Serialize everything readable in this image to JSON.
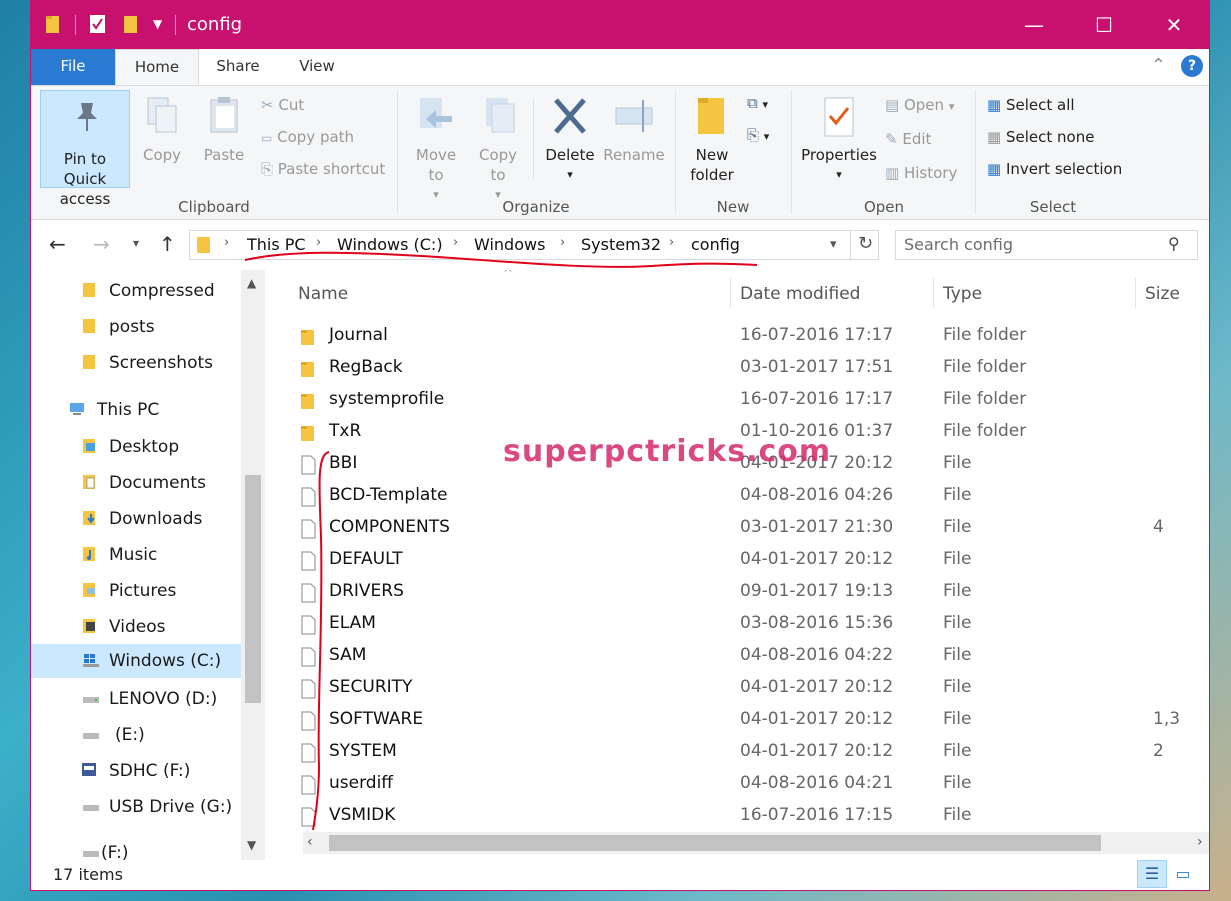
{
  "window": {
    "title": "config"
  },
  "tabs": [
    "File",
    "Home",
    "Share",
    "View"
  ],
  "ribbon": {
    "clipboard": {
      "label": "Clipboard",
      "pin": "Pin to Quick access",
      "copy": "Copy",
      "paste": "Paste",
      "cut": "Cut",
      "copy_path": "Copy path",
      "paste_shortcut": "Paste shortcut"
    },
    "organize": {
      "label": "Organize",
      "move_to": "Move to",
      "copy_to": "Copy to",
      "delete": "Delete",
      "rename": "Rename"
    },
    "new": {
      "label": "New",
      "new_folder": "New folder"
    },
    "open": {
      "label": "Open",
      "properties": "Properties",
      "open": "Open",
      "edit": "Edit",
      "history": "History"
    },
    "select": {
      "label": "Select",
      "select_all": "Select all",
      "select_none": "Select none",
      "invert": "Invert selection"
    }
  },
  "address": {
    "crumbs": [
      "This PC",
      "Windows (C:)",
      "Windows",
      "System32",
      "config"
    ],
    "search_placeholder": "Search config"
  },
  "nav": [
    {
      "label": "Compressed"
    },
    {
      "label": "posts"
    },
    {
      "label": "Screenshots"
    },
    {
      "label": "This PC"
    },
    {
      "label": "Desktop"
    },
    {
      "label": "Documents"
    },
    {
      "label": "Downloads"
    },
    {
      "label": "Music"
    },
    {
      "label": "Pictures"
    },
    {
      "label": "Videos"
    },
    {
      "label": "Windows (C:)"
    },
    {
      "label": "LENOVO (D:)"
    },
    {
      "label": "(E:)"
    },
    {
      "label": "SDHC (F:)"
    },
    {
      "label": "USB Drive (G:)"
    },
    {
      "label": "(F:)"
    }
  ],
  "columns": {
    "name": "Name",
    "date": "Date modified",
    "type": "Type",
    "size": "Size"
  },
  "files": [
    {
      "name": "Journal",
      "date": "16-07-2016 17:17",
      "type": "File folder",
      "size": "",
      "folder": true
    },
    {
      "name": "RegBack",
      "date": "03-01-2017 17:51",
      "type": "File folder",
      "size": "",
      "folder": true
    },
    {
      "name": "systemprofile",
      "date": "16-07-2016 17:17",
      "type": "File folder",
      "size": "",
      "folder": true
    },
    {
      "name": "TxR",
      "date": "01-10-2016 01:37",
      "type": "File folder",
      "size": "",
      "folder": true
    },
    {
      "name": "BBI",
      "date": "04-01-2017 20:12",
      "type": "File",
      "size": "",
      "folder": false
    },
    {
      "name": "BCD-Template",
      "date": "04-08-2016 04:26",
      "type": "File",
      "size": "",
      "folder": false
    },
    {
      "name": "COMPONENTS",
      "date": "03-01-2017 21:30",
      "type": "File",
      "size": "4",
      "folder": false
    },
    {
      "name": "DEFAULT",
      "date": "04-01-2017 20:12",
      "type": "File",
      "size": "",
      "folder": false
    },
    {
      "name": "DRIVERS",
      "date": "09-01-2017 19:13",
      "type": "File",
      "size": "",
      "folder": false
    },
    {
      "name": "ELAM",
      "date": "03-08-2016 15:36",
      "type": "File",
      "size": "",
      "folder": false
    },
    {
      "name": "SAM",
      "date": "04-08-2016 04:22",
      "type": "File",
      "size": "",
      "folder": false
    },
    {
      "name": "SECURITY",
      "date": "04-01-2017 20:12",
      "type": "File",
      "size": "",
      "folder": false
    },
    {
      "name": "SOFTWARE",
      "date": "04-01-2017 20:12",
      "type": "File",
      "size": "1,3",
      "folder": false
    },
    {
      "name": "SYSTEM",
      "date": "04-01-2017 20:12",
      "type": "File",
      "size": "2",
      "folder": false
    },
    {
      "name": "userdiff",
      "date": "04-08-2016 04:21",
      "type": "File",
      "size": "",
      "folder": false
    },
    {
      "name": "VSMIDK",
      "date": "16-07-2016 17:15",
      "type": "File",
      "size": "",
      "folder": false
    }
  ],
  "watermark": "superpctricks.com",
  "status": {
    "count": "17 items"
  },
  "colors": {
    "titlebar": "#c8106e",
    "file_tab": "#2a7ad2",
    "selection": "#cce8ff",
    "annotation": "#e0001a"
  }
}
